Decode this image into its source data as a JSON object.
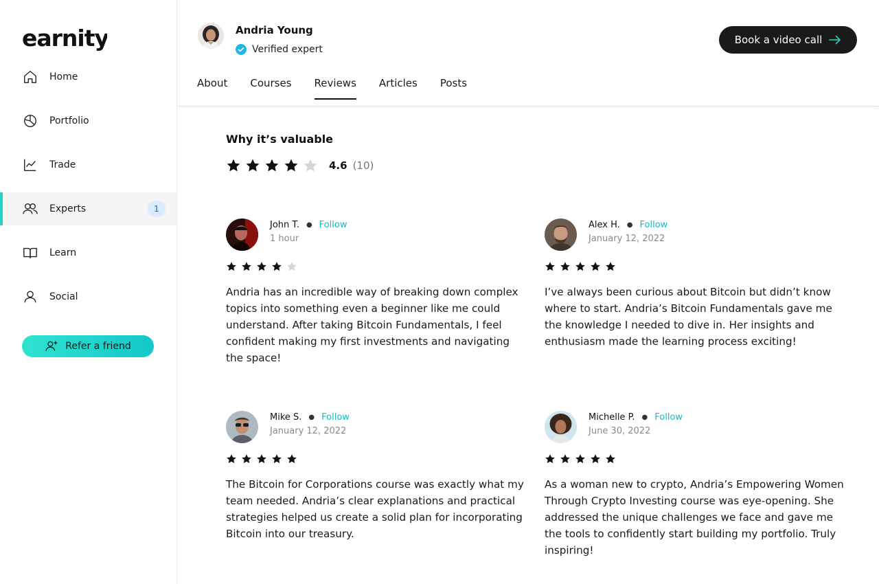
{
  "brand": {
    "logo_text": "earnity",
    "accent": "#22d3c5",
    "follow_color": "#17b8c4"
  },
  "sidebar": {
    "items": [
      {
        "label": "Home",
        "icon": "home-icon"
      },
      {
        "label": "Portfolio",
        "icon": "pie-chart-icon"
      },
      {
        "label": "Trade",
        "icon": "trend-chart-icon"
      },
      {
        "label": "Experts",
        "icon": "users-icon",
        "badge": "1",
        "active": true
      },
      {
        "label": "Learn",
        "icon": "book-icon"
      },
      {
        "label": "Social",
        "icon": "user-icon"
      }
    ],
    "refer_label": "Refer a friend"
  },
  "header": {
    "name": "Andria Young",
    "verified_label": "Verified expert",
    "book_label": "Book a video call",
    "tabs": [
      {
        "label": "About"
      },
      {
        "label": "Courses"
      },
      {
        "label": "Reviews",
        "active": true
      },
      {
        "label": "Articles"
      },
      {
        "label": "Posts"
      }
    ]
  },
  "summary": {
    "title": "Why it’s valuable",
    "rating": "4.6",
    "count": "(10)",
    "stars_filled": 4,
    "stars_total": 5
  },
  "reviews": [
    {
      "name": "John T.",
      "follow": "Follow",
      "time": "1 hour",
      "stars": 4,
      "text": "Andria has an incredible way of breaking down complex topics into something even a beginner like me could understand. After taking Bitcoin Fundamentals, I feel confident making my first investments and navigating the space!"
    },
    {
      "name": "Alex H.",
      "follow": "Follow",
      "time": "January 12, 2022",
      "stars": 5,
      "text": "I’ve always been curious about Bitcoin but didn’t know where to start. Andria’s Bitcoin Fundamentals gave me the knowledge I needed to dive in. Her insights and enthusiasm made the learning process exciting!"
    },
    {
      "name": "Mike S.",
      "follow": "Follow",
      "time": "January 12, 2022",
      "stars": 5,
      "text": "The Bitcoin for Corporations course was exactly what my team needed. Andria’s clear explanations and practical strategies helped us create a solid plan for incorporating Bitcoin into our treasury."
    },
    {
      "name": "Michelle P.",
      "follow": "Follow",
      "time": "June 30, 2022",
      "stars": 5,
      "text": "As a woman new to crypto, Andria’s Empowering Women Through Crypto Investing course was eye-opening. She addressed the unique challenges we face and gave me the tools to confidently start building my portfolio. Truly inspiring!"
    }
  ]
}
